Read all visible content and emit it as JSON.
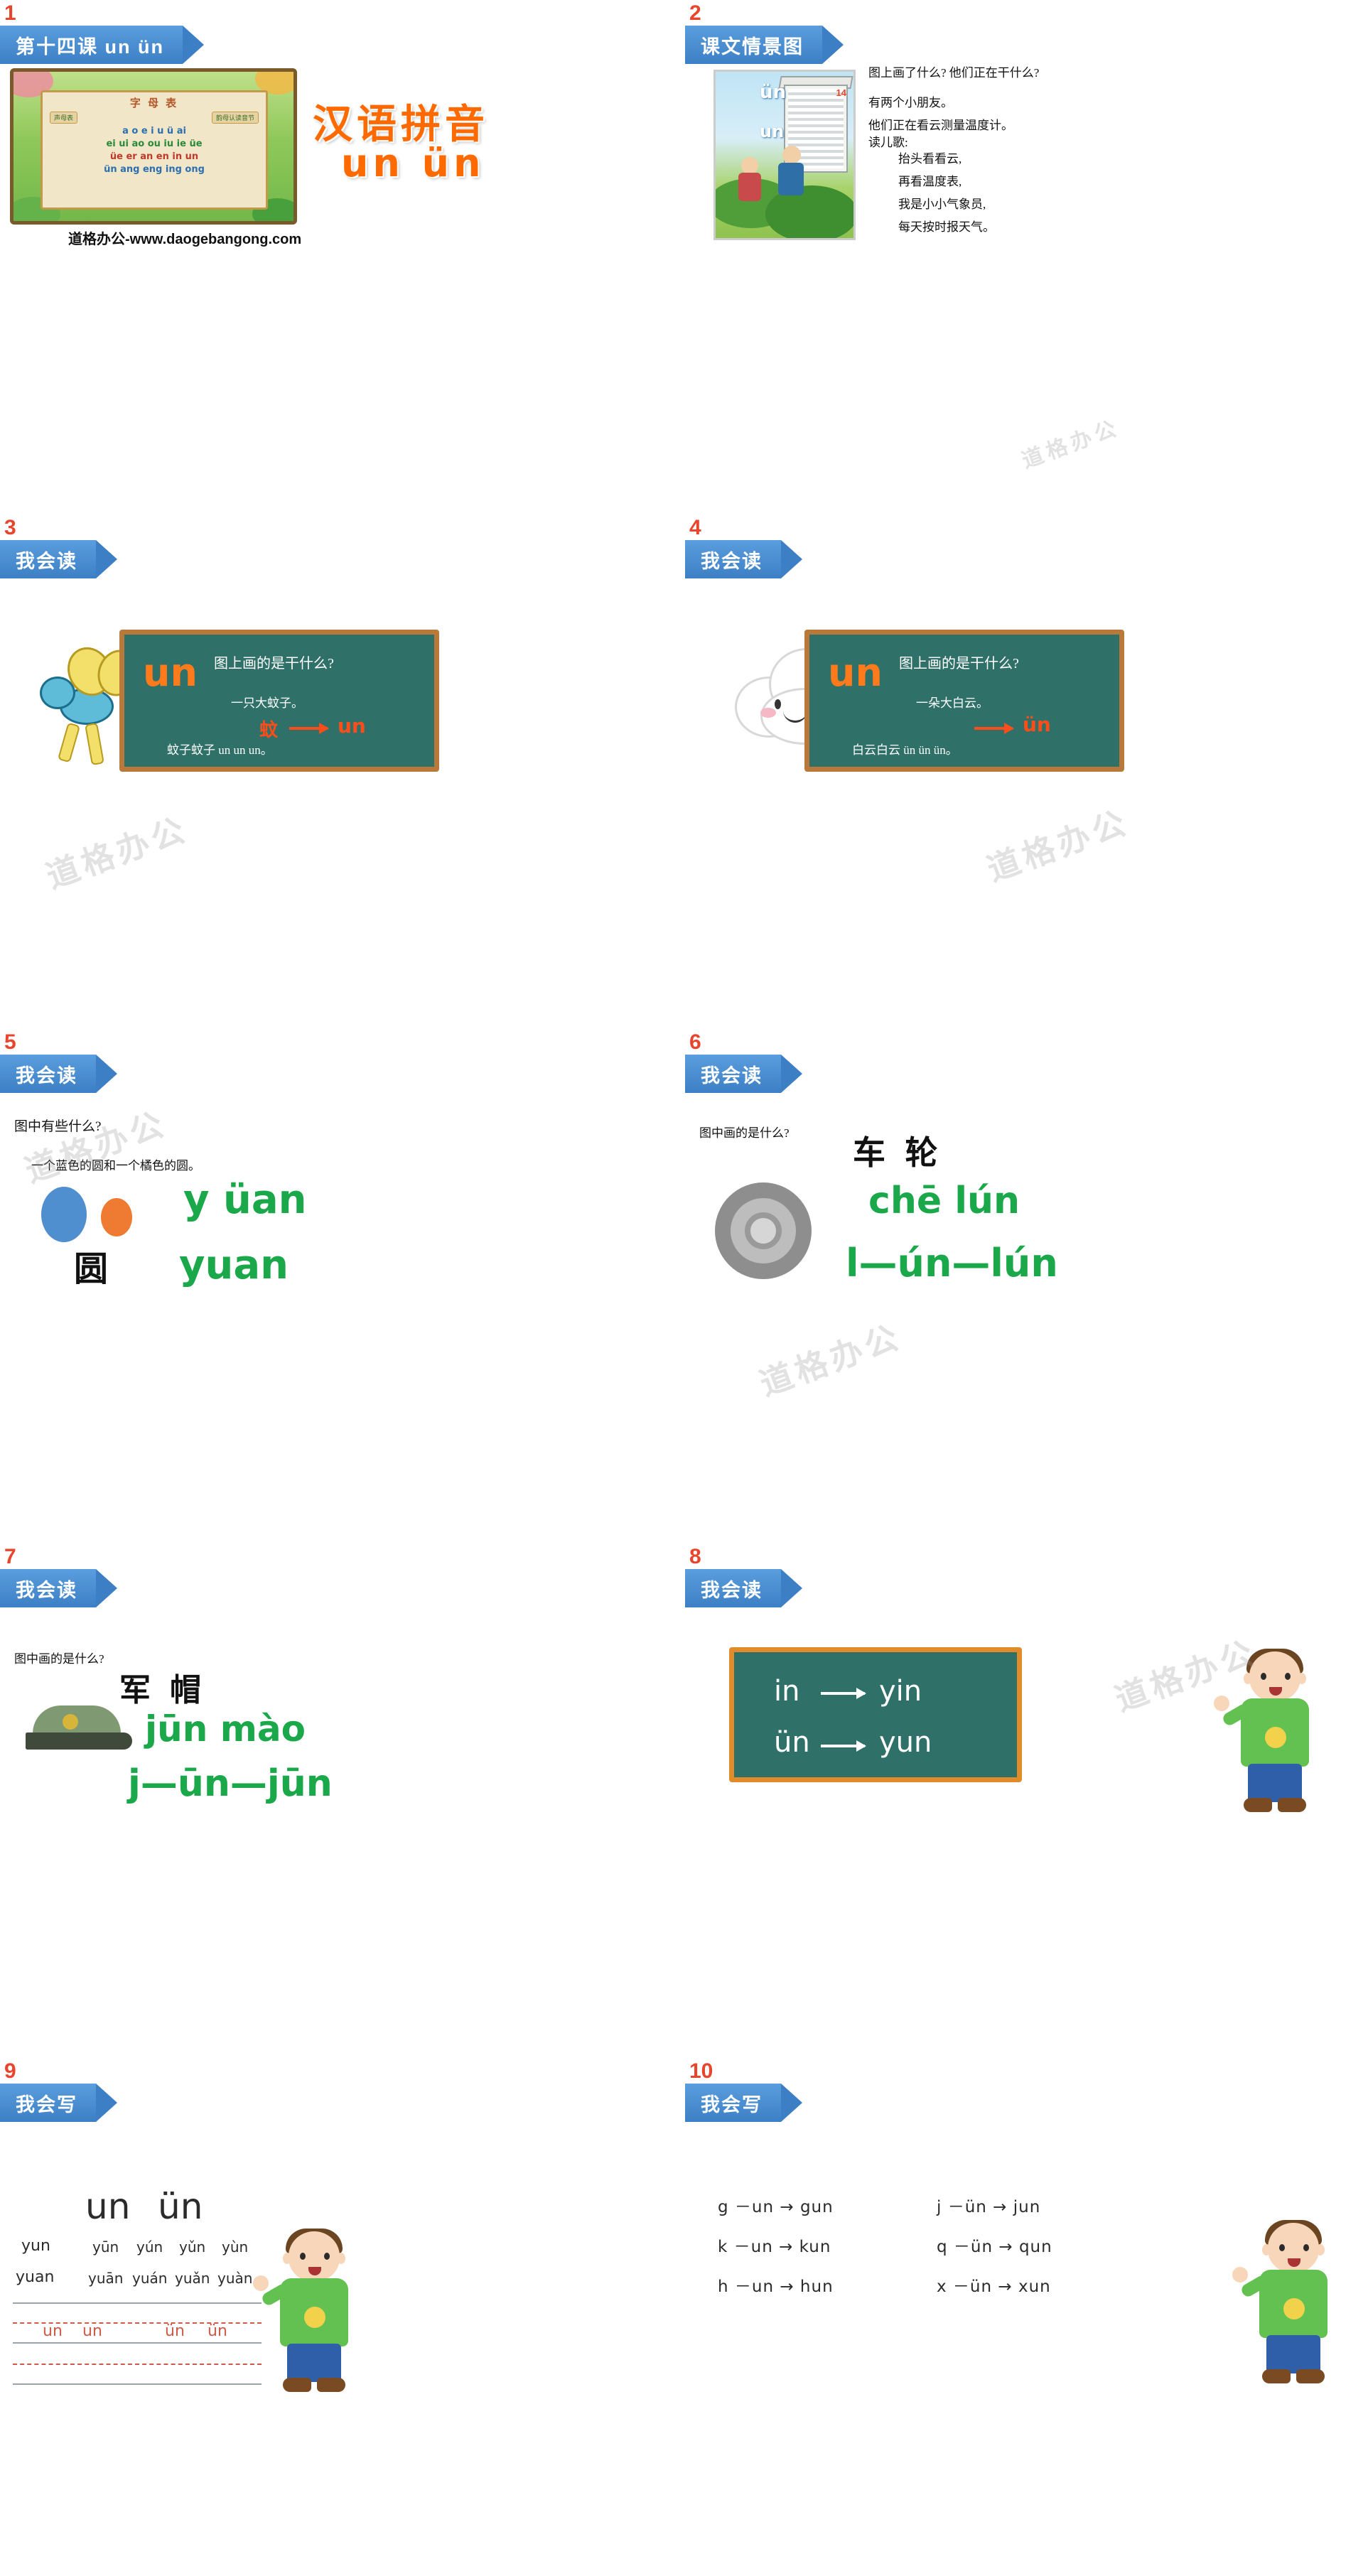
{
  "deck": {
    "slides": [
      {
        "number": "1",
        "banner": "第十四课 un ün",
        "title_cn": "汉语拼音",
        "title_py": "un ün",
        "credit": "道格办公-www.daogebangong.com",
        "chart_title": "字 母 表",
        "chart_tags": [
          "声母表",
          "韵母认读音节"
        ],
        "chart_rows": [
          "a o e i u ü ai",
          "ei ui ao ou iu ie üe",
          "üe er an en in un",
          "ün ang eng ing ong"
        ]
      },
      {
        "number": "2",
        "banner": "课文情景图",
        "q1": "图上画了什么? 他们正在干什么?",
        "a1": "有两个小朋友。",
        "a2": "他们正在看云测量温度计。",
        "read_label": "读儿歌:",
        "poem": [
          "抬头看看云,",
          "再看温度表,",
          "我是小小气象员,",
          "每天按时报天气。"
        ],
        "img_un_top": "ün",
        "img_un_bottom": "un",
        "img_badge": "14"
      },
      {
        "number": "3",
        "banner": "我会读",
        "board_q": "图上画的是干什么?",
        "board_a": "一只大蚊子。",
        "board_line": "蚊子蚊子 un un un。",
        "big": "un",
        "zi": "蚊",
        "target": "un"
      },
      {
        "number": "4",
        "banner": "我会读",
        "board_q": "图上画的是干什么?",
        "board_a": "一朵大白云。",
        "board_line": "白云白云 ün ün ün。",
        "big": "un",
        "target": "ün"
      },
      {
        "number": "5",
        "banner": "我会读",
        "q": "图中有些什么?",
        "a": "一个蓝色的圆和一个橘色的圆。",
        "py1": "y üan",
        "py2": "yuan",
        "word": "圆"
      },
      {
        "number": "6",
        "banner": "我会读",
        "q": "图中画的是什么?",
        "word": "车 轮",
        "py": "chē lún",
        "split": "l—ún—lún"
      },
      {
        "number": "7",
        "banner": "我会读",
        "q": "图中画的是什么?",
        "word": "军 帽",
        "py": "jūn mào",
        "split": "j—ūn—jūn"
      },
      {
        "number": "8",
        "banner": "我会读",
        "line1_left": "in",
        "line1_right": "yin",
        "line2_left": "ün",
        "line2_right": "yun"
      },
      {
        "number": "9",
        "banner": "我会写",
        "big1": "un",
        "big2": "ün",
        "col_left": [
          "yun",
          "yuan"
        ],
        "row1": [
          "yūn",
          "yún",
          "yǔn",
          "yùn"
        ],
        "row2": [
          "yuān",
          "yuán",
          "yuǎn",
          "yuàn"
        ],
        "practice": [
          "un",
          "un",
          "ün",
          "ün"
        ]
      },
      {
        "number": "10",
        "banner": "我会写",
        "left_rows": [
          "g －un → gun",
          "k －un → kun",
          "h －un → hun"
        ],
        "right_rows": [
          "j －ün → jun",
          "q －ün → qun",
          "x －ün → xun"
        ]
      }
    ],
    "watermarks": [
      "道格办公",
      "道格办公",
      "道格办公",
      "道格办公",
      "道格办公",
      "道格办公"
    ],
    "colors": {
      "banner": "#3d7fc4",
      "number": "#e8452c",
      "orange": "#ff6a00",
      "green": "#1aa84a",
      "board": "#2f7168",
      "board_frame": "#b9793a"
    }
  }
}
